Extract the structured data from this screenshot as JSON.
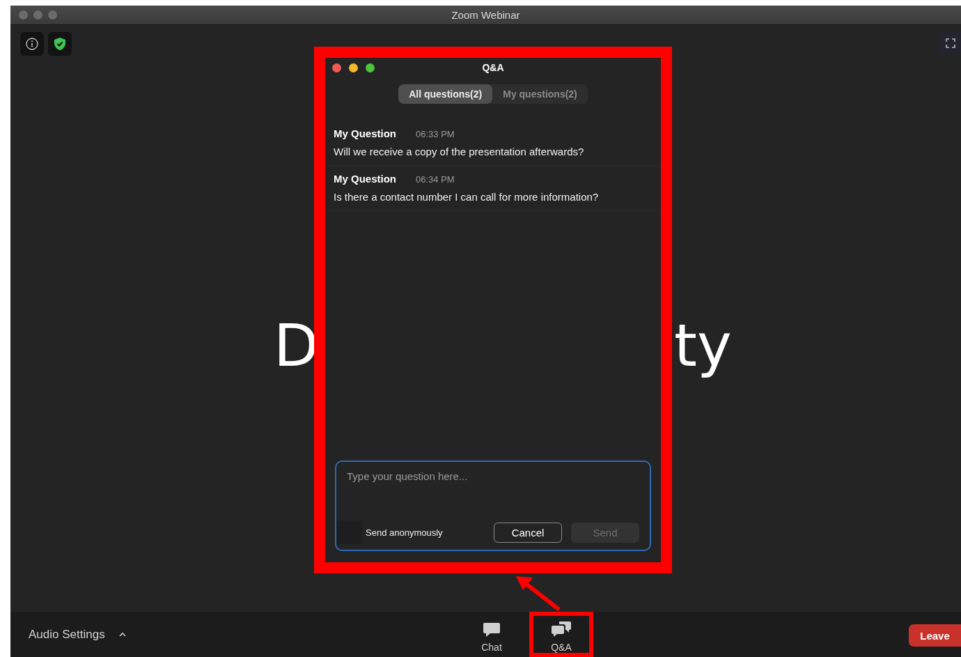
{
  "window": {
    "title": "Zoom Webinar"
  },
  "shared_screen": {
    "fragments": [
      "D",
      "ty"
    ]
  },
  "qa_panel": {
    "title": "Q&A",
    "tabs": [
      {
        "label": "All questions(2)",
        "selected": true
      },
      {
        "label": "My questions(2)",
        "selected": false
      }
    ],
    "questions": [
      {
        "author": "My Question",
        "time": "06:33 PM",
        "text": "Will we receive a copy of the presentation afterwards?"
      },
      {
        "author": "My Question",
        "time": "06:34 PM",
        "text": "Is there a contact number I can call for more information?"
      }
    ],
    "input": {
      "placeholder": "Type your question here..."
    },
    "send_anonymously": {
      "label": "Send anonymously",
      "checked": false
    },
    "buttons": [
      {
        "label": "Cancel",
        "disabled": false
      },
      {
        "label": "Send",
        "disabled": true
      }
    ]
  },
  "toolbar": {
    "audio_settings": "Audio Settings",
    "items": [
      {
        "label": "Chat",
        "kind": "chat",
        "highlighted": false
      },
      {
        "label": "Q&A",
        "kind": "qa",
        "highlighted": true
      }
    ],
    "leave": "Leave"
  }
}
